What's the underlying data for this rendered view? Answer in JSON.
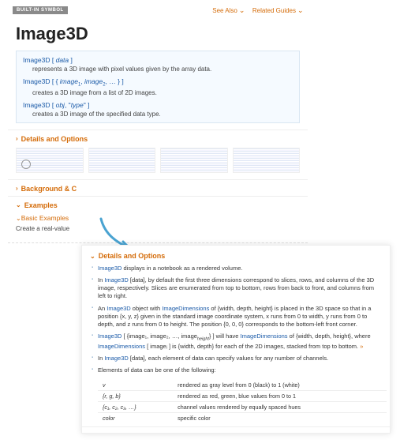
{
  "top": {
    "builtin": "BUILT-IN SYMBOL",
    "see_also": "See Also",
    "related": "Related Guides"
  },
  "title": "Image3D",
  "sigs": [
    {
      "head": "Image3D [ data ]",
      "desc": "represents a 3D image with pixel values given by the array data."
    },
    {
      "head": "Image3D [ { image₁, image₂, … } ]",
      "desc": "creates a 3D image from a list of 2D images."
    },
    {
      "head": "Image3D [ obj, \"type\" ]",
      "desc": "creates a 3D image of the specified data type."
    }
  ],
  "sections": {
    "details": "Details and Options",
    "background": "Background & C",
    "examples": "Examples",
    "basic": "Basic Examples",
    "basic_line": "Create a real-value"
  },
  "front": {
    "heading": "Details and Options",
    "b1a": "Image3D",
    "b1b": " displays in a notebook as a rendered volume.",
    "b2a": "In ",
    "b2b": "Image3D",
    "b2c": " [data], by default the first three dimensions correspond to slices, rows, and columns of the 3D image, respectively. Slices are enumerated from top to bottom, rows from back to front, and columns from left to right.",
    "b3a": "An ",
    "b3b": "Image3D",
    "b3c": " object with ",
    "b3d": "ImageDimensions",
    "b3e": " of {width, depth, height} is placed in the 3D space so that in a position {x, y, z} given in the standard image coordinate system, x runs from 0 to width, y runs from 0 to depth, and z runs from 0 to height. The position {0, 0, 0} corresponds to the bottom-left front corner.",
    "b4a": "Image3D",
    "b4b": " [ {image₁, image₂, …, image",
    "b4c": "height",
    "b4d": "} ] will have ",
    "b4e": "ImageDimensions",
    "b4f": " of {width, depth, height}, where ",
    "b4g": "ImageDimensions",
    "b4h": " [ imageᵢ ] is {width, depth} for each of the 2D images, stacked from top to bottom. ",
    "b4i": "»",
    "b5a": "In ",
    "b5b": "Image3D",
    "b5c": " [data], each element of data can specify values for any number of channels.",
    "b6": "Elements of data can be one of the following:",
    "tbl": [
      {
        "k": "v",
        "v": "rendered as gray level from 0 (black) to 1 (white)"
      },
      {
        "k": "{r, g, b}",
        "v": "rendered as red, green, blue values from 0 to 1"
      },
      {
        "k": "{c₁, c₂, c₃, …}",
        "v": "channel values rendered by equally spaced hues"
      },
      {
        "k": "color",
        "v": "specific color"
      }
    ]
  }
}
